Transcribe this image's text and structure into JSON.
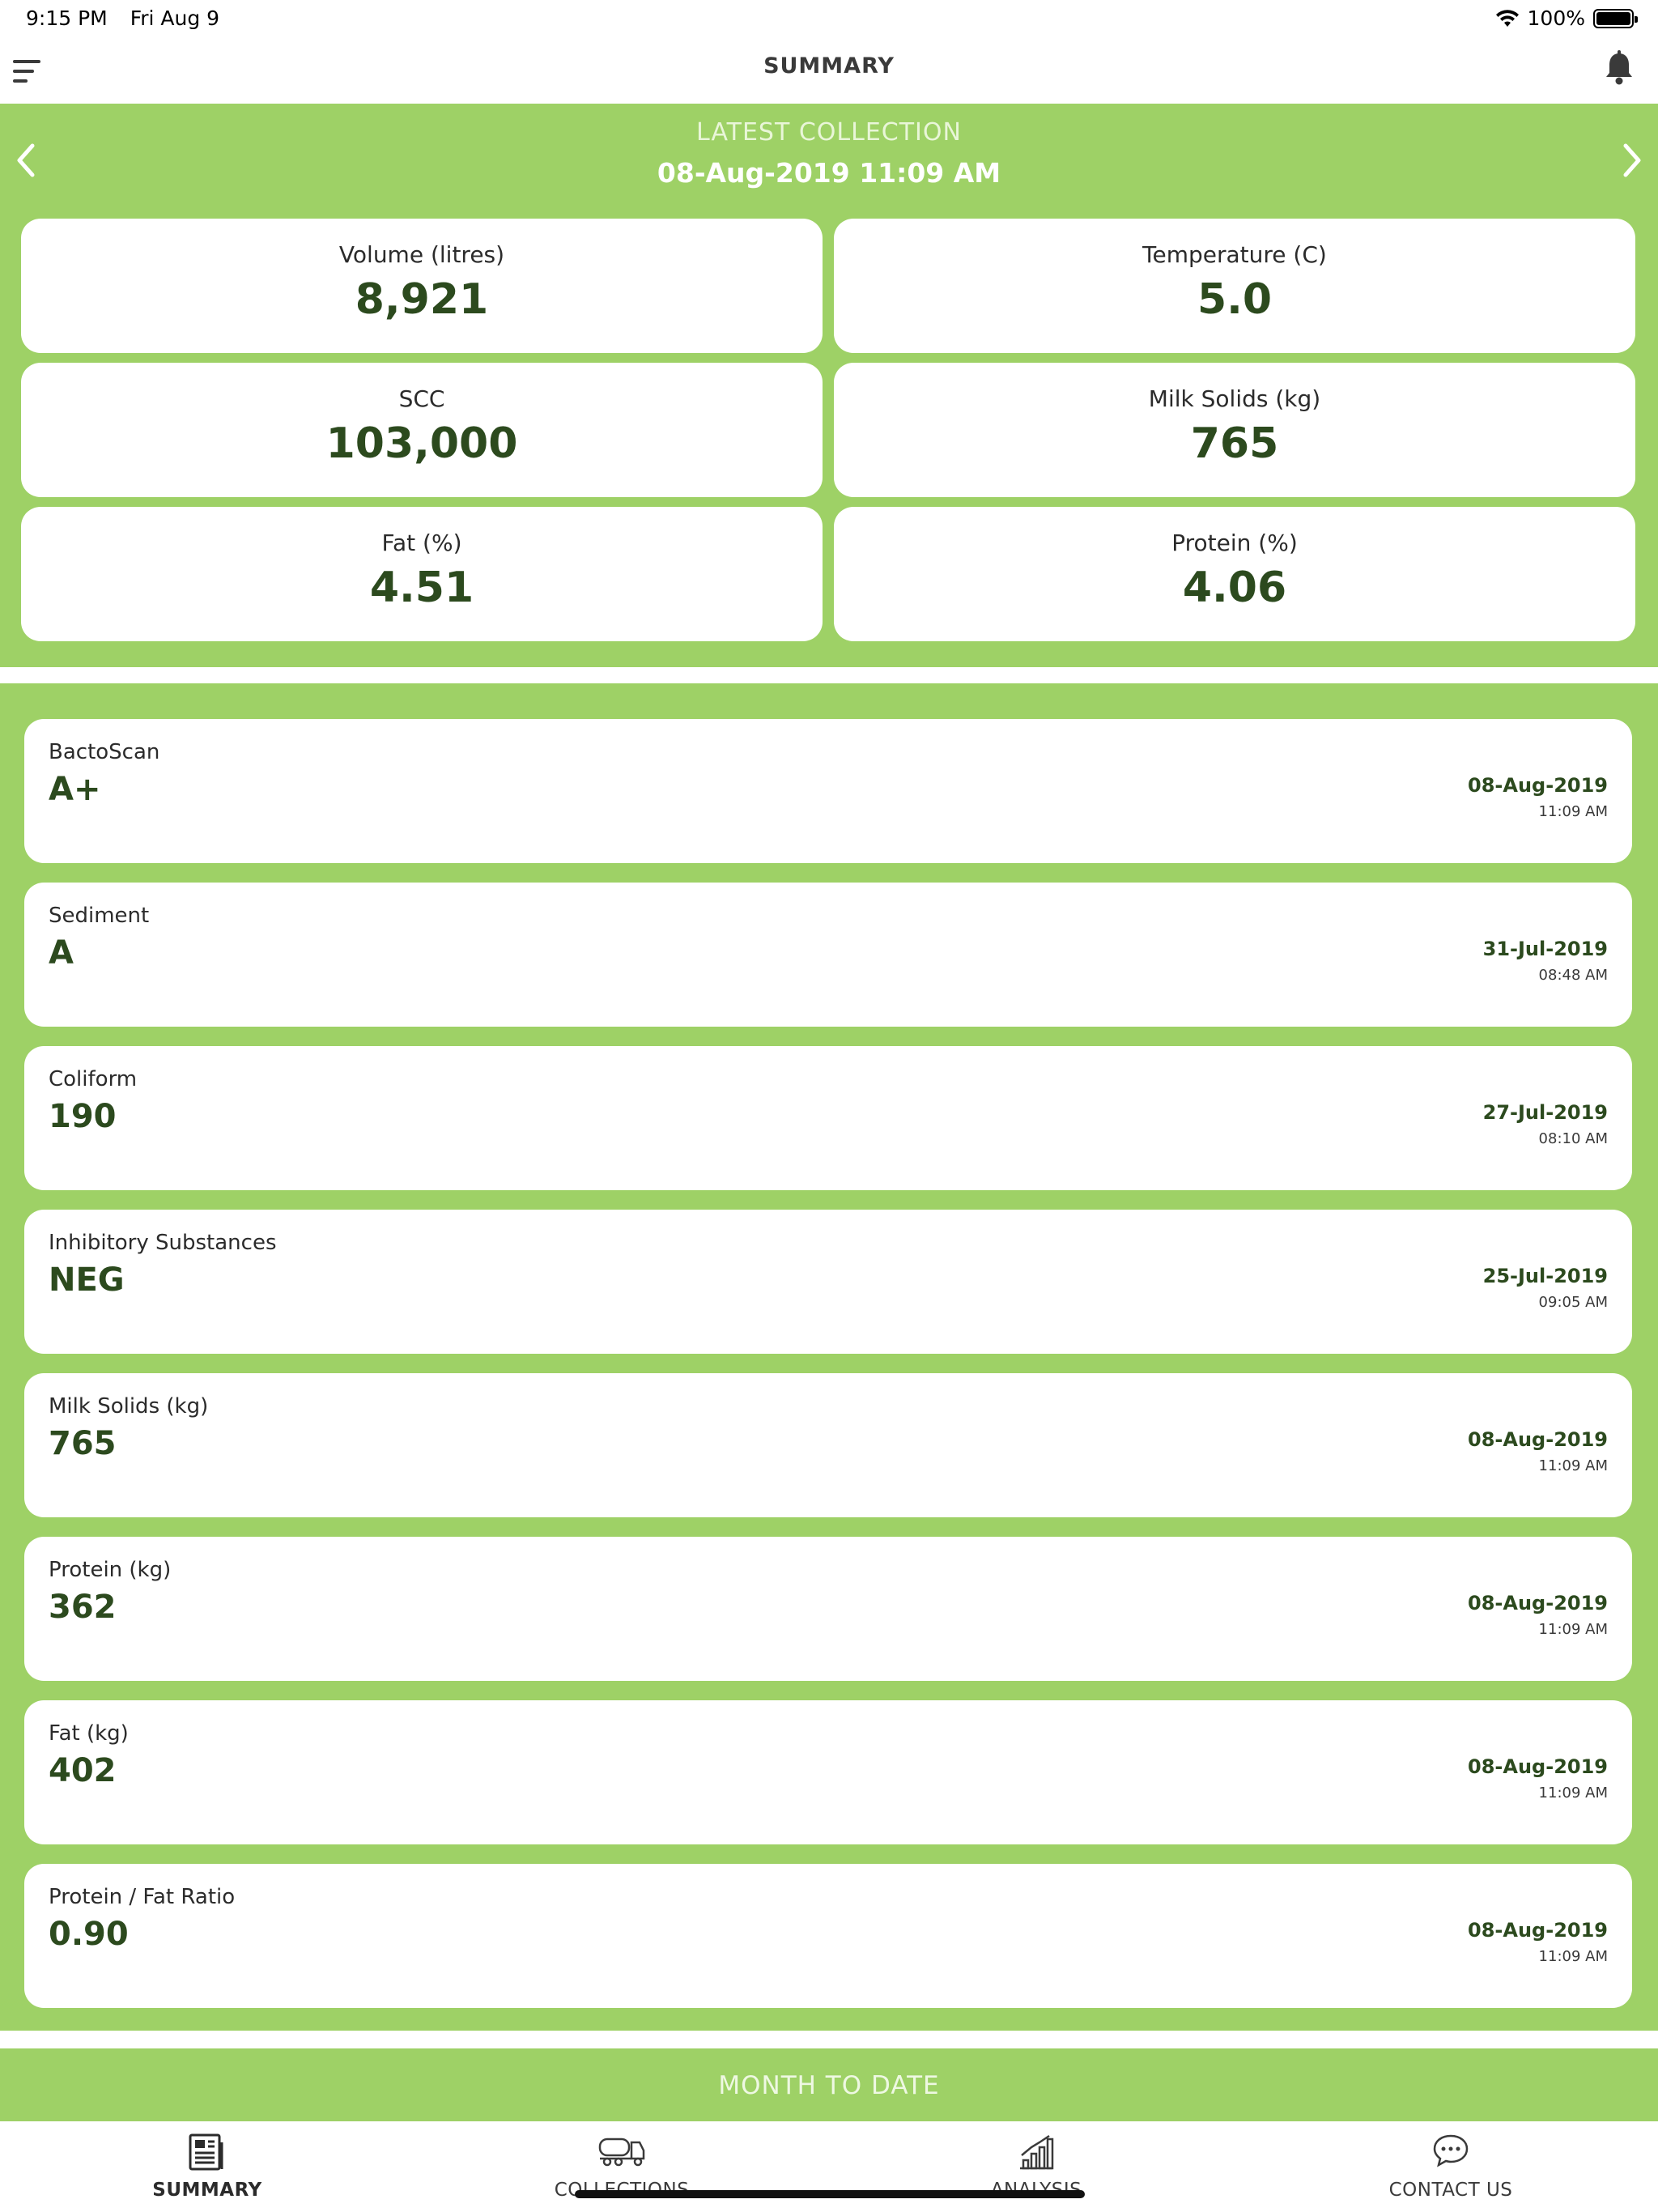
{
  "status": {
    "time": "9:15 PM",
    "date": "Fri Aug 9",
    "battery": "100%"
  },
  "nav": {
    "title": "SUMMARY"
  },
  "latest": {
    "label": "LATEST COLLECTION",
    "datetime": "08-Aug-2019 11:09 AM",
    "stats": [
      {
        "label": "Volume (litres)",
        "value": "8,921"
      },
      {
        "label": "Temperature (C)",
        "value": "5.0"
      },
      {
        "label": "SCC",
        "value": "103,000"
      },
      {
        "label": "Milk Solids (kg)",
        "value": "765"
      },
      {
        "label": "Fat (%)",
        "value": "4.51"
      },
      {
        "label": "Protein (%)",
        "value": "4.06"
      }
    ]
  },
  "quality": [
    {
      "label": "BactoScan",
      "value": "A+",
      "date": "08-Aug-2019",
      "time": "11:09 AM"
    },
    {
      "label": "Sediment",
      "value": "A",
      "date": "31-Jul-2019",
      "time": "08:48 AM"
    },
    {
      "label": "Coliform",
      "value": "190",
      "date": "27-Jul-2019",
      "time": "08:10 AM"
    },
    {
      "label": "Inhibitory Substances",
      "value": "NEG",
      "date": "25-Jul-2019",
      "time": "09:05 AM"
    },
    {
      "label": "Milk Solids (kg)",
      "value": "765",
      "date": "08-Aug-2019",
      "time": "11:09 AM"
    },
    {
      "label": "Protein (kg)",
      "value": "362",
      "date": "08-Aug-2019",
      "time": "11:09 AM"
    },
    {
      "label": "Fat (kg)",
      "value": "402",
      "date": "08-Aug-2019",
      "time": "11:09 AM"
    },
    {
      "label": "Protein / Fat Ratio",
      "value": "0.90",
      "date": "08-Aug-2019",
      "time": "11:09 AM"
    }
  ],
  "month_to_date": {
    "label": "MONTH TO DATE"
  },
  "tabs": [
    {
      "label": "SUMMARY",
      "icon": "summary-icon"
    },
    {
      "label": "COLLECTIONS",
      "icon": "truck-icon"
    },
    {
      "label": "ANALYSIS",
      "icon": "chart-icon"
    },
    {
      "label": "CONTACT US",
      "icon": "chat-icon"
    }
  ],
  "colors": {
    "accent_green": "#9ed166",
    "value_text": "#2c4a1e"
  }
}
